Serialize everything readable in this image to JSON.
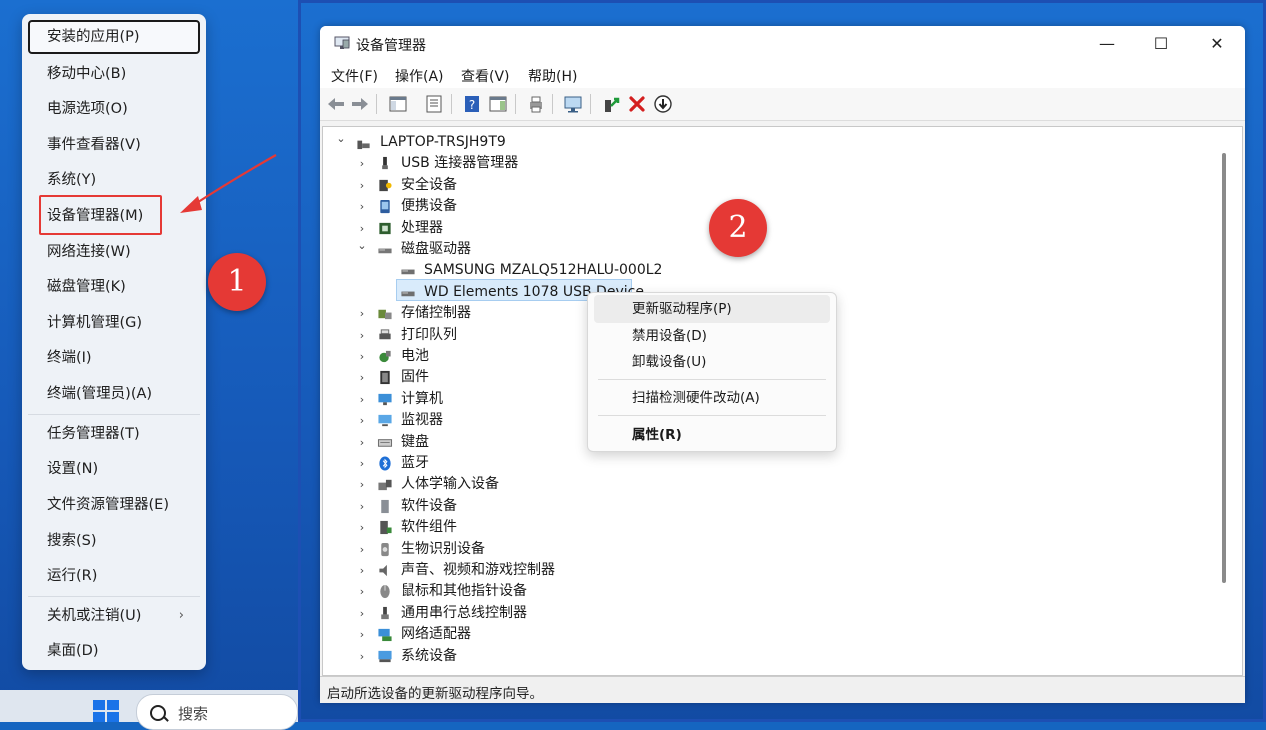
{
  "winx_menu": {
    "items": [
      {
        "label": "安装的应用(P)"
      },
      {
        "label": "移动中心(B)"
      },
      {
        "label": "电源选项(O)"
      },
      {
        "label": "事件查看器(V)"
      },
      {
        "label": "系统(Y)"
      },
      {
        "label": "设备管理器(M)"
      },
      {
        "label": "网络连接(W)"
      },
      {
        "label": "磁盘管理(K)"
      },
      {
        "label": "计算机管理(G)"
      },
      {
        "label": "终端(I)"
      },
      {
        "label": "终端(管理员)(A)"
      },
      {
        "label": "任务管理器(T)"
      },
      {
        "label": "设置(N)"
      },
      {
        "label": "文件资源管理器(E)"
      },
      {
        "label": "搜索(S)"
      },
      {
        "label": "运行(R)"
      },
      {
        "label": "关机或注销(U)"
      },
      {
        "label": "桌面(D)"
      }
    ],
    "submenu_arrow": "›"
  },
  "annotations": {
    "step1": "1",
    "step2": "2"
  },
  "taskbar": {
    "search_label": "搜索"
  },
  "window": {
    "title": "设备管理器",
    "controls": {
      "minimize": "—",
      "maximize": "☐",
      "close": "✕"
    },
    "menus": [
      "文件(F)",
      "操作(A)",
      "查看(V)",
      "帮助(H)"
    ],
    "root": "LAPTOP-TRSJH9T9",
    "categories": [
      {
        "label": "USB 连接器管理器",
        "icon": "usb-icon"
      },
      {
        "label": "安全设备",
        "icon": "security-icon"
      },
      {
        "label": "便携设备",
        "icon": "portable-icon"
      },
      {
        "label": "处理器",
        "icon": "cpu-icon"
      },
      {
        "label": "磁盘驱动器",
        "icon": "disk-icon",
        "expanded": true,
        "children": [
          "SAMSUNG MZALQ512HALU-000L2",
          "WD Elements 1078 USB Device"
        ]
      },
      {
        "label": "存储控制器",
        "icon": "storage-icon"
      },
      {
        "label": "打印队列",
        "icon": "printer-icon"
      },
      {
        "label": "电池",
        "icon": "battery-icon"
      },
      {
        "label": "固件",
        "icon": "firmware-icon"
      },
      {
        "label": "计算机",
        "icon": "computer-icon"
      },
      {
        "label": "监视器",
        "icon": "monitor-icon"
      },
      {
        "label": "键盘",
        "icon": "keyboard-icon"
      },
      {
        "label": "蓝牙",
        "icon": "bluetooth-icon"
      },
      {
        "label": "人体学输入设备",
        "icon": "hid-icon"
      },
      {
        "label": "软件设备",
        "icon": "software-device-icon"
      },
      {
        "label": "软件组件",
        "icon": "software-component-icon"
      },
      {
        "label": "生物识别设备",
        "icon": "biometric-icon"
      },
      {
        "label": "声音、视频和游戏控制器",
        "icon": "audio-icon"
      },
      {
        "label": "鼠标和其他指针设备",
        "icon": "mouse-icon"
      },
      {
        "label": "通用串行总线控制器",
        "icon": "usb-controller-icon"
      },
      {
        "label": "网络适配器",
        "icon": "network-icon"
      },
      {
        "label": "系统设备",
        "icon": "system-icon"
      }
    ],
    "status": "启动所选设备的更新驱动程序向导。"
  },
  "context_menu": {
    "items": [
      "更新驱动程序(P)",
      "禁用设备(D)",
      "卸载设备(U)",
      "扫描检测硬件改动(A)",
      "属性(R)"
    ]
  },
  "colors": {
    "accent": "#1a73e8",
    "annotation_red": "#e53935",
    "selection": "#d9ebfb"
  }
}
